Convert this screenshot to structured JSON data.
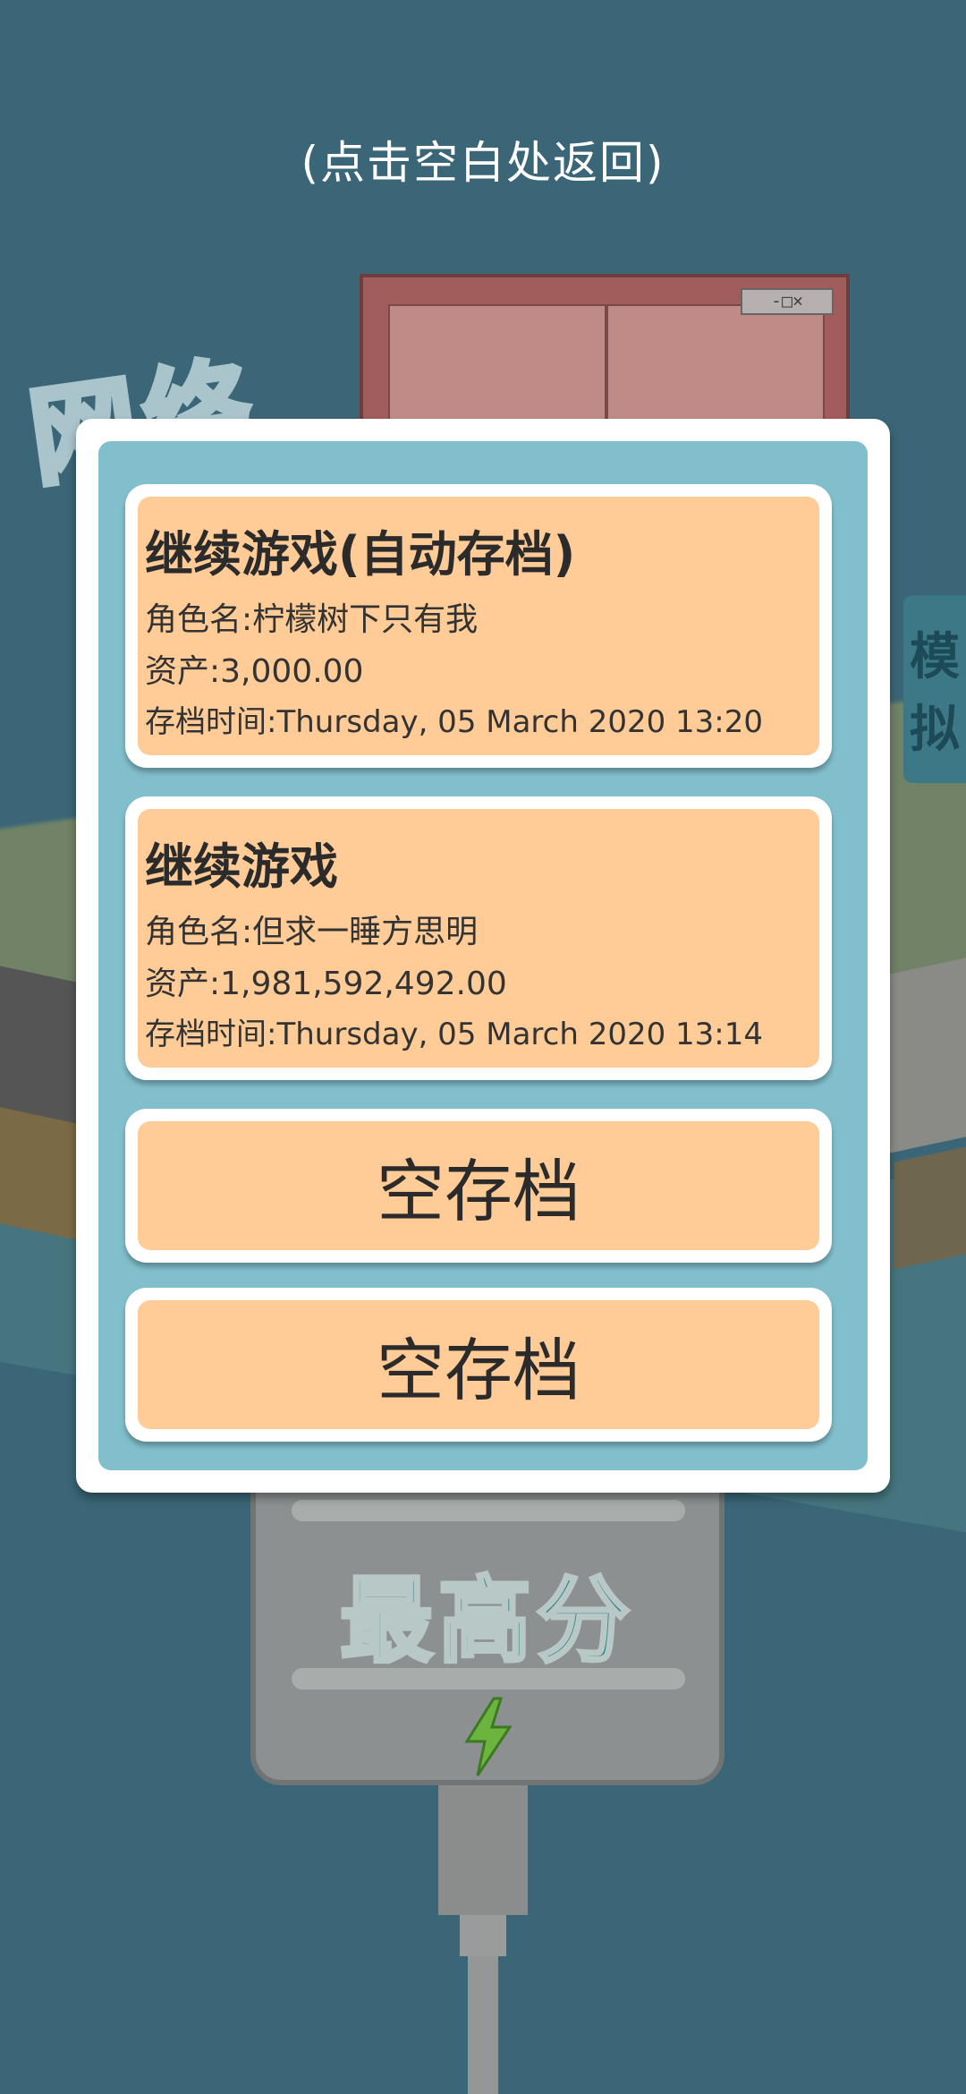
{
  "hint": "(点击空白处返回)",
  "background": {
    "window_controls": "-□×",
    "logo_text": "网络",
    "side_card_text": [
      "模",
      "拟"
    ],
    "highscore_label": "最高分",
    "icons": [
      "lightning-bolt-icon"
    ]
  },
  "save_slots": [
    {
      "title": "继续游戏(自动存档)",
      "role_label": "角色名:",
      "role_name": "柠檬树下只有我",
      "assets_label": "资产:",
      "assets": "3,000.00",
      "time_label": "存档时间:",
      "time": "Thursday, 05 March 2020 13:20"
    },
    {
      "title": "继续游戏",
      "role_label": "角色名:",
      "role_name": "但求一睡方思明",
      "assets_label": "资产:",
      "assets": "1,981,592,492.00",
      "time_label": "存档时间:",
      "time": "Thursday, 05 March 2020 13:14"
    },
    {
      "empty_label": "空存档"
    },
    {
      "empty_label": "空存档"
    }
  ],
  "colors": {
    "background": "#3a6677",
    "dialog_frame": "#82bfcd",
    "slot_face": "#ffcb96"
  }
}
